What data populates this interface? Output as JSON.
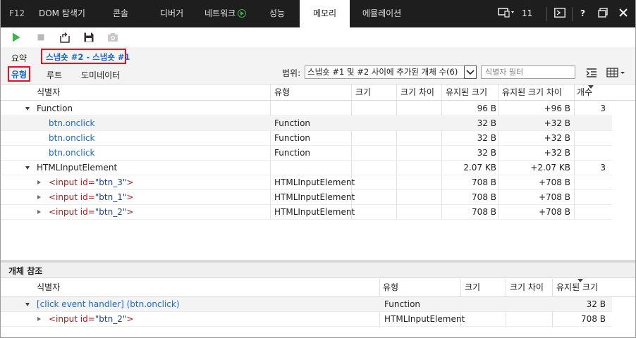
{
  "devtools_tabs": {
    "f12": "F12",
    "dom": "DOM 탐색기",
    "console": "콘솔",
    "debugger": "디버거",
    "network": "네트워크",
    "performance": "성능",
    "memory": "메모리",
    "emulation": "에뮬레이션",
    "error_count": "11",
    "help": "?"
  },
  "view": {
    "summary": "요약",
    "snapshot_compare": "스냅숏 #2 - 스냅숏 #1",
    "types": "유형",
    "roots": "루트",
    "dominators": "도미네이터",
    "scope_label": "범위:",
    "scope_value": "스냅숏 #1 및 #2 사이에 추가된 개체 수(6)",
    "filter_placeholder": "식별자 필터"
  },
  "grid": {
    "columns": [
      "식별자",
      "유형",
      "크기",
      "크기 차이",
      "유지된 크기",
      "유지된 크기 차이",
      "개수"
    ],
    "rows": [
      {
        "name": "Function",
        "type": "",
        "size": "",
        "size_diff": "",
        "retained": "96 B",
        "retained_diff": "+96 B",
        "count": "3"
      },
      {
        "name": "btn.onclick",
        "type": "Function",
        "size": "",
        "size_diff": "",
        "retained": "32 B",
        "retained_diff": "+32 B",
        "count": ""
      },
      {
        "name": "btn.onclick",
        "type": "Function",
        "size": "",
        "size_diff": "",
        "retained": "32 B",
        "retained_diff": "+32 B",
        "count": ""
      },
      {
        "name": "btn.onclick",
        "type": "Function",
        "size": "",
        "size_diff": "",
        "retained": "32 B",
        "retained_diff": "+32 B",
        "count": ""
      },
      {
        "name": "HTMLInputElement",
        "type": "",
        "size": "",
        "size_diff": "",
        "retained": "2.07 KB",
        "retained_diff": "+2.07 KB",
        "count": "3"
      },
      {
        "tag": "<input",
        "attr": "id=",
        "val": "\"btn_3\"",
        "close": ">",
        "type": "HTMLInputElement",
        "size": "",
        "size_diff": "",
        "retained": "708 B",
        "retained_diff": "+708 B",
        "count": ""
      },
      {
        "tag": "<input",
        "attr": "id=",
        "val": "\"btn_1\"",
        "close": ">",
        "type": "HTMLInputElement",
        "size": "",
        "size_diff": "",
        "retained": "708 B",
        "retained_diff": "+708 B",
        "count": ""
      },
      {
        "tag": "<input",
        "attr": "id=",
        "val": "\"btn_2\"",
        "close": ">",
        "type": "HTMLInputElement",
        "size": "",
        "size_diff": "",
        "retained": "708 B",
        "retained_diff": "+708 B",
        "count": ""
      }
    ]
  },
  "refs": {
    "title": "개체 참조",
    "columns": [
      "식별자",
      "유형",
      "크기",
      "크기 차이",
      "유지된 크기"
    ],
    "rows": [
      {
        "name": "[click event handler] (btn.onclick)",
        "type": "Function",
        "size": "",
        "size_diff": "",
        "retained": "32 B"
      },
      {
        "tag": "<input",
        "attr": "id=",
        "val": "\"btn_2\"",
        "close": ">",
        "type": "HTMLInputElement",
        "size": "",
        "size_diff": "",
        "retained": "708 B"
      }
    ]
  },
  "colors": {
    "accent_blue": "#1b6ac9",
    "highlight_red": "#e81123",
    "run_green": "#3fb34f"
  }
}
